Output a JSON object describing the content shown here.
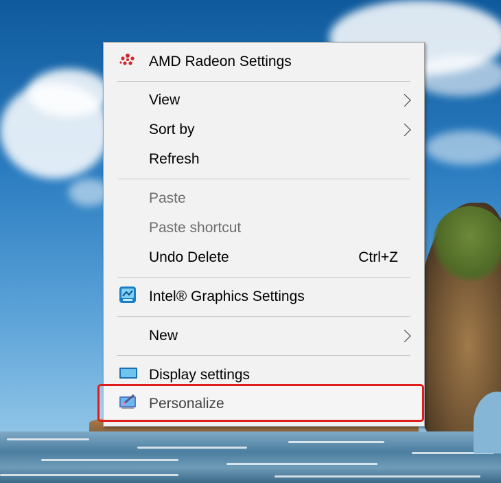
{
  "menu": {
    "amd": "AMD Radeon Settings",
    "view": "View",
    "sort_by": "Sort by",
    "refresh": "Refresh",
    "paste": "Paste",
    "paste_shortcut": "Paste shortcut",
    "undo_delete": "Undo Delete",
    "undo_shortcut": "Ctrl+Z",
    "intel": "Intel® Graphics Settings",
    "new": "New",
    "display": "Display settings",
    "personalize": "Personalize"
  },
  "icons": {
    "amd": "amd-radeon-icon",
    "intel": "intel-graphics-icon",
    "display": "display-settings-icon",
    "personalize": "personalize-icon"
  },
  "colors": {
    "highlight_border": "#e01b1b",
    "menu_background": "#f2f2f2",
    "disabled_text": "#6d6d6d",
    "amd_red": "#d4252c"
  }
}
